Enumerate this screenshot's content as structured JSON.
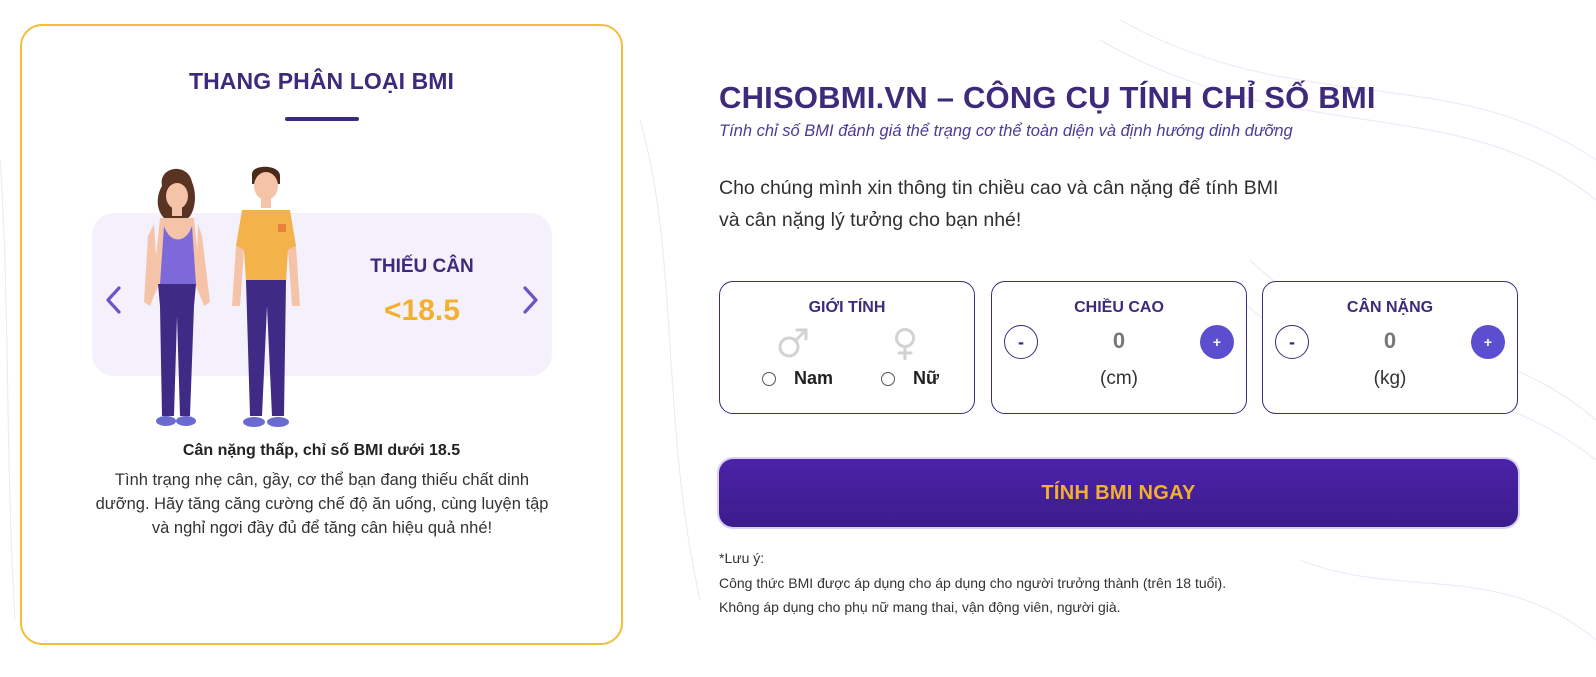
{
  "scale_card": {
    "title": "THANG PHÂN LOẠI BMI",
    "category_label": "THIẾU CÂN",
    "category_value": "<18.5",
    "description_title": "Cân nặng thấp, chỉ số BMI dưới 18.5",
    "description_text": "Tình trạng nhẹ cân, gầy, cơ thể bạn đang thiếu chất dinh dưỡng. Hãy tăng căng cường chế độ ăn uống, cùng luyện tập và nghỉ ngơi đầy đủ để tăng cân hiệu quả nhé!",
    "prev_icon": "chevron-left-icon",
    "next_icon": "chevron-right-icon"
  },
  "header": {
    "title": "CHISOBMI.VN – CÔNG CỤ TÍNH CHỈ SỐ BMI",
    "subtitle": "Tính chỉ số BMI đánh giá thể trạng cơ thể toàn diện và định hướng dinh dưỡng"
  },
  "intro": "Cho chúng mình xin thông tin chiều cao và cân nặng để tính BMI và cân nặng lý tưởng cho bạn nhé!",
  "form": {
    "gender": {
      "label": "GIỚI TÍNH",
      "options": [
        {
          "label": "Nam",
          "icon": "male-icon"
        },
        {
          "label": "Nữ",
          "icon": "female-icon"
        }
      ]
    },
    "height": {
      "label": "CHIỀU CAO",
      "value": "0",
      "unit": "(cm)",
      "minus": "-",
      "plus": "+"
    },
    "weight": {
      "label": "CÂN NẶNG",
      "value": "0",
      "unit": "(kg)",
      "minus": "-",
      "plus": "+"
    },
    "submit_label": "TÍNH BMI NGAY"
  },
  "note": {
    "heading": "*Lưu ý:",
    "lines": [
      "Công thức BMI được áp dụng cho áp dụng cho người trưởng thành (trên 18 tuổi).",
      "Không áp dụng cho phụ nữ mang thai, vận động viên, người già."
    ]
  },
  "colors": {
    "brand_purple": "#3d2a7a",
    "accent_yellow": "#f3b02e",
    "card_border": "#f3bf3b",
    "plus_button": "#5b4fd0"
  }
}
